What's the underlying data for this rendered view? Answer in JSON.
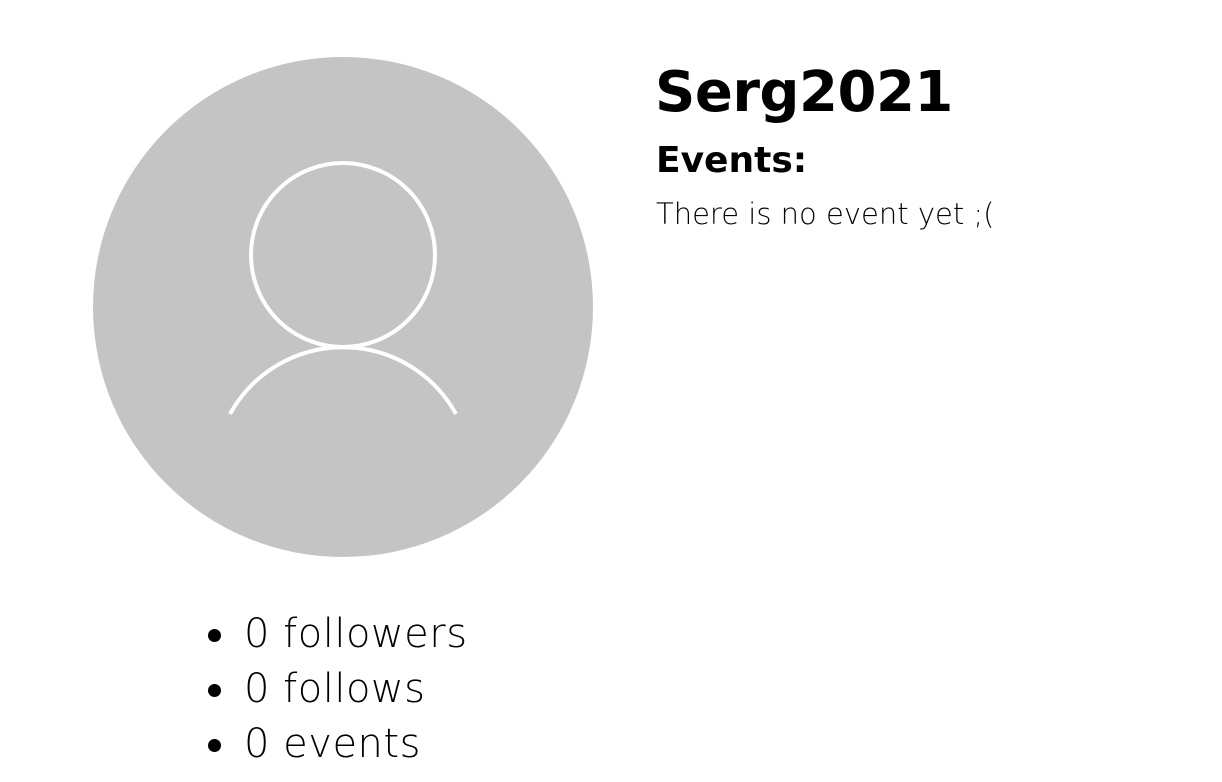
{
  "profile": {
    "username": "Serg2021",
    "avatar_icon": "user-icon"
  },
  "stats": [
    {
      "label": "0 followers"
    },
    {
      "label": "0 follows"
    },
    {
      "label": "0 events"
    }
  ],
  "events": {
    "heading": "Events:",
    "empty_message": "There is no event yet ;("
  },
  "colors": {
    "avatar_background": "#c4c4c4",
    "avatar_icon_stroke": "#ffffff",
    "text": "#000000",
    "page_background": "#ffffff"
  }
}
